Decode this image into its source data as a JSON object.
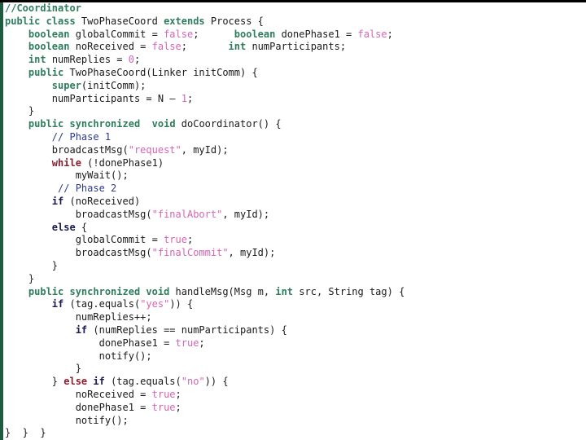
{
  "slide": {
    "title": "TwoPhaseCoord coordinator source listing",
    "language": "java",
    "colors": {
      "background": "#ffffff",
      "top_rule": "#000000",
      "left_rule": "#1f5c3f",
      "type_keyword": "#2e7d5b",
      "control_keyword": "#8a1f2e",
      "conditional_keyword": "#1a1a4e",
      "literal": "#d664b4",
      "header_comment": "#2e7d5b",
      "inline_comment": "#2b3b8f",
      "identifier": "#1a1a1a"
    }
  },
  "code": {
    "lines": [
      [
        {
          "t": "//Coordinator",
          "c": "cmt-top"
        }
      ],
      [
        {
          "t": "public class ",
          "c": "kw-type"
        },
        {
          "t": "TwoPhaseCoord ",
          "c": "plain"
        },
        {
          "t": "extends ",
          "c": "kw-type"
        },
        {
          "t": "Process {",
          "c": "plain"
        }
      ],
      [
        {
          "t": "    ",
          "c": "plain"
        },
        {
          "t": "boolean ",
          "c": "kw-type"
        },
        {
          "t": "globalCommit = ",
          "c": "plain"
        },
        {
          "t": "false",
          "c": "lit"
        },
        {
          "t": ";      ",
          "c": "plain"
        },
        {
          "t": "boolean ",
          "c": "kw-type"
        },
        {
          "t": "donePhase1 = ",
          "c": "plain"
        },
        {
          "t": "false",
          "c": "lit"
        },
        {
          "t": ";",
          "c": "plain"
        }
      ],
      [
        {
          "t": "    ",
          "c": "plain"
        },
        {
          "t": "boolean ",
          "c": "kw-type"
        },
        {
          "t": "noReceived = ",
          "c": "plain"
        },
        {
          "t": "false",
          "c": "lit"
        },
        {
          "t": ";       ",
          "c": "plain"
        },
        {
          "t": "int ",
          "c": "kw-type"
        },
        {
          "t": "numParticipants;",
          "c": "plain"
        }
      ],
      [
        {
          "t": "    ",
          "c": "plain"
        },
        {
          "t": "int ",
          "c": "kw-type"
        },
        {
          "t": "numReplies = ",
          "c": "plain"
        },
        {
          "t": "0",
          "c": "lit"
        },
        {
          "t": ";",
          "c": "plain"
        }
      ],
      [
        {
          "t": "    ",
          "c": "plain"
        },
        {
          "t": "public ",
          "c": "kw-type"
        },
        {
          "t": "TwoPhaseCoord(Linker initComm) {",
          "c": "plain"
        }
      ],
      [
        {
          "t": "        ",
          "c": "plain"
        },
        {
          "t": "super",
          "c": "kw-type"
        },
        {
          "t": "(initComm);",
          "c": "plain"
        }
      ],
      [
        {
          "t": "        numParticipants = N ",
          "c": "plain"
        },
        {
          "t": "– ",
          "c": "plain"
        },
        {
          "t": "1",
          "c": "lit"
        },
        {
          "t": ";",
          "c": "plain"
        }
      ],
      [
        {
          "t": "    }",
          "c": "plain"
        }
      ],
      [
        {
          "t": "    ",
          "c": "plain"
        },
        {
          "t": "public synchronized ",
          "c": "kw-type"
        },
        {
          "t": " ",
          "c": "plain"
        },
        {
          "t": "void ",
          "c": "kw-type"
        },
        {
          "t": "doCoordinator() {",
          "c": "plain"
        }
      ],
      [
        {
          "t": "        ",
          "c": "plain"
        },
        {
          "t": "// Phase 1",
          "c": "cmt"
        }
      ],
      [
        {
          "t": "        broadcastMsg(",
          "c": "plain"
        },
        {
          "t": "\"request\"",
          "c": "lit"
        },
        {
          "t": ", myId);",
          "c": "plain"
        }
      ],
      [
        {
          "t": "        ",
          "c": "plain"
        },
        {
          "t": "while ",
          "c": "kw-ctrl"
        },
        {
          "t": "(!donePhase1)",
          "c": "plain"
        }
      ],
      [
        {
          "t": "            myWait();",
          "c": "plain"
        }
      ],
      [
        {
          "t": "         ",
          "c": "plain"
        },
        {
          "t": "// Phase 2",
          "c": "cmt"
        }
      ],
      [
        {
          "t": "        ",
          "c": "plain"
        },
        {
          "t": "if ",
          "c": "kw-cond"
        },
        {
          "t": "(noReceived)",
          "c": "plain"
        }
      ],
      [
        {
          "t": "            broadcastMsg(",
          "c": "plain"
        },
        {
          "t": "\"finalAbort\"",
          "c": "lit"
        },
        {
          "t": ", myId);",
          "c": "plain"
        }
      ],
      [
        {
          "t": "        ",
          "c": "plain"
        },
        {
          "t": "else ",
          "c": "kw-cond"
        },
        {
          "t": "{",
          "c": "plain"
        }
      ],
      [
        {
          "t": "            globalCommit = ",
          "c": "plain"
        },
        {
          "t": "true",
          "c": "lit"
        },
        {
          "t": ";",
          "c": "plain"
        }
      ],
      [
        {
          "t": "            broadcastMsg(",
          "c": "plain"
        },
        {
          "t": "\"finalCommit\"",
          "c": "lit"
        },
        {
          "t": ", myId);",
          "c": "plain"
        }
      ],
      [
        {
          "t": "        }",
          "c": "plain"
        }
      ],
      [
        {
          "t": "    }",
          "c": "plain"
        }
      ],
      [
        {
          "t": "    ",
          "c": "plain"
        },
        {
          "t": "public synchronized void ",
          "c": "kw-type"
        },
        {
          "t": "handleMsg(Msg m, ",
          "c": "plain"
        },
        {
          "t": "int ",
          "c": "kw-type"
        },
        {
          "t": "src, String tag) {",
          "c": "plain"
        }
      ],
      [
        {
          "t": "        ",
          "c": "plain"
        },
        {
          "t": "if ",
          "c": "kw-cond"
        },
        {
          "t": "(tag.equals(",
          "c": "plain"
        },
        {
          "t": "\"yes\"",
          "c": "lit"
        },
        {
          "t": ")) {",
          "c": "plain"
        }
      ],
      [
        {
          "t": "            numReplies++;",
          "c": "plain"
        }
      ],
      [
        {
          "t": "            ",
          "c": "plain"
        },
        {
          "t": "if ",
          "c": "kw-cond"
        },
        {
          "t": "(numReplies == numParticipants) {",
          "c": "plain"
        }
      ],
      [
        {
          "t": "                donePhase1 = ",
          "c": "plain"
        },
        {
          "t": "true",
          "c": "lit"
        },
        {
          "t": ";",
          "c": "plain"
        }
      ],
      [
        {
          "t": "                notify();",
          "c": "plain"
        }
      ],
      [
        {
          "t": "            }",
          "c": "plain"
        }
      ],
      [
        {
          "t": "        } ",
          "c": "plain"
        },
        {
          "t": "else ",
          "c": "kw-ctrl"
        },
        {
          "t": "if ",
          "c": "kw-cond"
        },
        {
          "t": "(tag.equals(",
          "c": "plain"
        },
        {
          "t": "\"no\"",
          "c": "lit"
        },
        {
          "t": ")) {",
          "c": "plain"
        }
      ],
      [
        {
          "t": "            noReceived = ",
          "c": "plain"
        },
        {
          "t": "true",
          "c": "lit"
        },
        {
          "t": ";",
          "c": "plain"
        }
      ],
      [
        {
          "t": "            donePhase1 = ",
          "c": "plain"
        },
        {
          "t": "true",
          "c": "lit"
        },
        {
          "t": ";",
          "c": "plain"
        }
      ],
      [
        {
          "t": "            notify();",
          "c": "plain"
        }
      ],
      [
        {
          "t": "}  }  }",
          "c": "plain"
        }
      ]
    ]
  }
}
